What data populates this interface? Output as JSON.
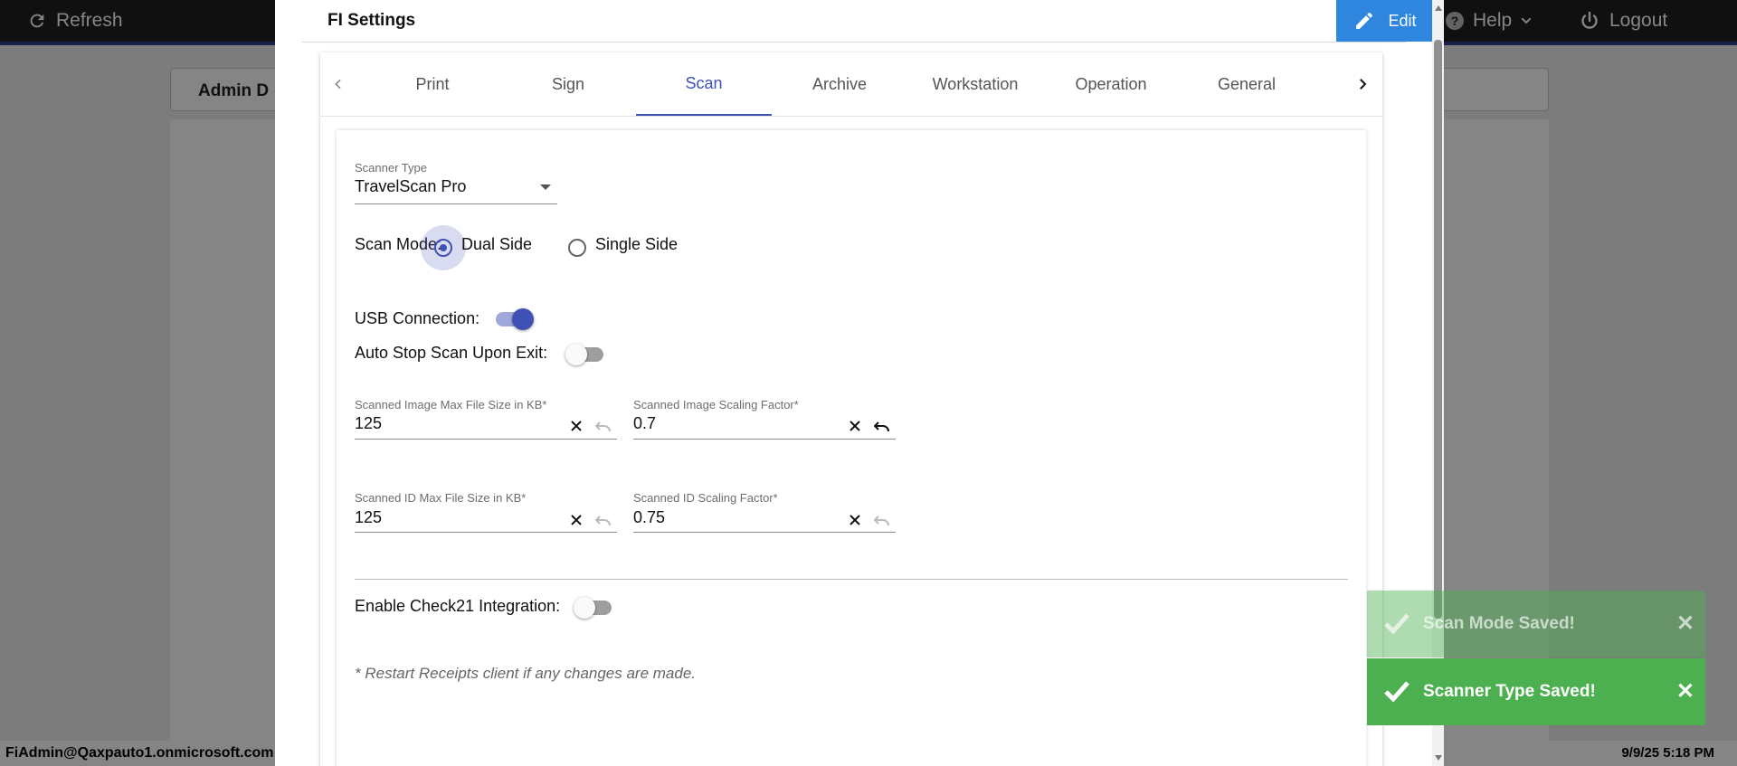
{
  "topbar": {
    "refresh_label": "Refresh",
    "help_label": "Help",
    "logout_label": "Logout"
  },
  "admin": {
    "title": "Admin D"
  },
  "footer": {
    "user": "FiAdmin@Qaxpauto1.onmicrosoft.com",
    "datetime": "9/9/25 5:18 PM"
  },
  "modal": {
    "title": "FI Settings",
    "edit_label": "Edit",
    "tabs": [
      {
        "label": "Print"
      },
      {
        "label": "Sign"
      },
      {
        "label": "Scan"
      },
      {
        "label": "Archive"
      },
      {
        "label": "Workstation"
      },
      {
        "label": "Operation"
      },
      {
        "label": "General"
      }
    ],
    "active_tab": "Scan"
  },
  "scan": {
    "scanner_type_label": "Scanner Type",
    "scanner_type_value": "TravelScan Pro",
    "scan_mode_label": "Scan Mode:",
    "scan_mode_options": [
      "Dual Side",
      "Single Side"
    ],
    "scan_mode_selected": "Dual Side",
    "usb_label": "USB Connection:",
    "usb_on": true,
    "auto_stop_label": "Auto Stop Scan Upon Exit:",
    "auto_stop_on": false,
    "image_max_label": "Scanned Image Max File Size in KB*",
    "image_max_value": "125",
    "image_scaling_label": "Scanned Image Scaling Factor*",
    "image_scaling_value": "0.7",
    "id_max_label": "Scanned ID Max File Size in KB*",
    "id_max_value": "125",
    "id_scaling_label": "Scanned ID Scaling Factor*",
    "id_scaling_value": "0.75",
    "check21_label": "Enable Check21 Integration:",
    "check21_on": false,
    "note": "* Restart Receipts client if any changes are made."
  },
  "toasts": [
    {
      "text": "Scan Mode Saved!"
    },
    {
      "text": "Scanner Type Saved!"
    }
  ],
  "colors": {
    "accent": "#3f51b5",
    "edit_button": "#2e86de",
    "toast_success": "#4caf50",
    "topbar": "#1f1f1f"
  }
}
